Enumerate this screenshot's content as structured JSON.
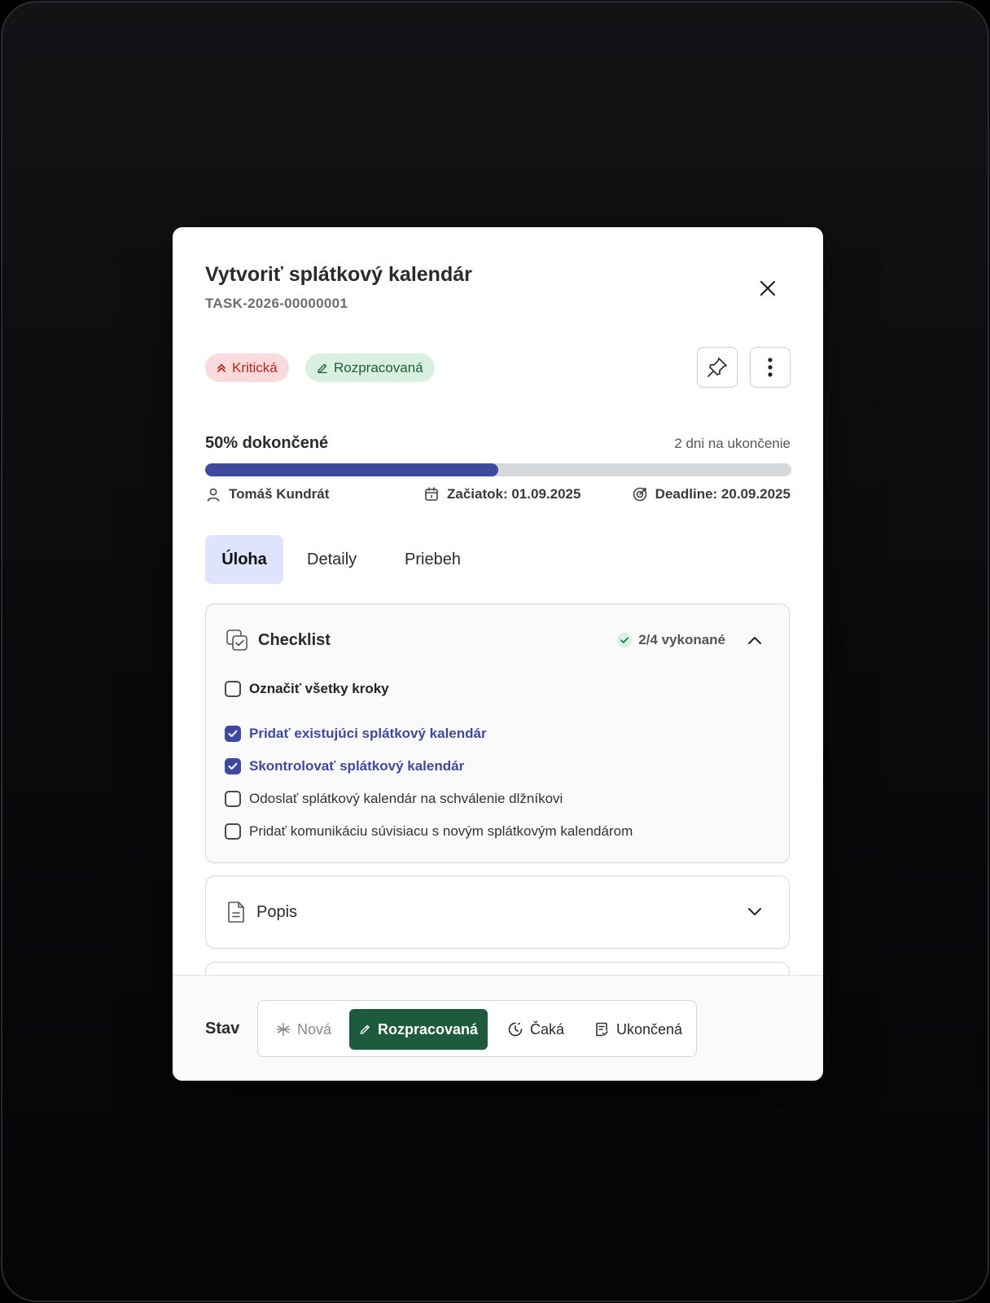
{
  "task": {
    "title": "Vytvoriť splátkový kalendár",
    "code": "TASK-2026-00000001"
  },
  "badges": {
    "priority": "Kritická",
    "status": "Rozpracovaná"
  },
  "progress": {
    "label": "50% dokončené",
    "percent": 50,
    "remaining": "2 dni na ukončenie"
  },
  "meta": {
    "assignee": "Tomáš Kundrát",
    "start": "Začiatok: 01.09.2025",
    "deadline": "Deadline: 20.09.2025"
  },
  "tabs": [
    {
      "label": "Úloha",
      "active": true
    },
    {
      "label": "Detaily",
      "active": false
    },
    {
      "label": "Priebeh",
      "active": false
    }
  ],
  "checklist": {
    "title": "Checklist",
    "done_count": "2/4 vykonané",
    "select_all": "Označiť všetky kroky",
    "items": [
      {
        "label": "Pridať existujúci splátkový kalendár",
        "checked": true
      },
      {
        "label": "Skontrolovať splátkový kalendár",
        "checked": true
      },
      {
        "label": "Odoslať splátkový kalendár na schválenie dlžníkovi",
        "checked": false
      },
      {
        "label": "Pridať komunikáciu súvisiacu s novým splátkovým kalendárom",
        "checked": false
      }
    ]
  },
  "popis": {
    "title": "Popis"
  },
  "footer": {
    "label": "Stav",
    "states": [
      {
        "label": "Nová",
        "icon": "asterisk-icon"
      },
      {
        "label": "Rozpracovaná",
        "icon": "pencil-icon",
        "active": true
      },
      {
        "label": "Čaká",
        "icon": "clock-icon"
      },
      {
        "label": "Ukončená",
        "icon": "document-check-icon"
      }
    ]
  },
  "colors": {
    "accent": "#3f4a9e",
    "active_state": "#1e5a3d",
    "critical_bg": "#fadadb",
    "critical_text": "#b3261e",
    "status_bg": "#d8f0e0"
  }
}
